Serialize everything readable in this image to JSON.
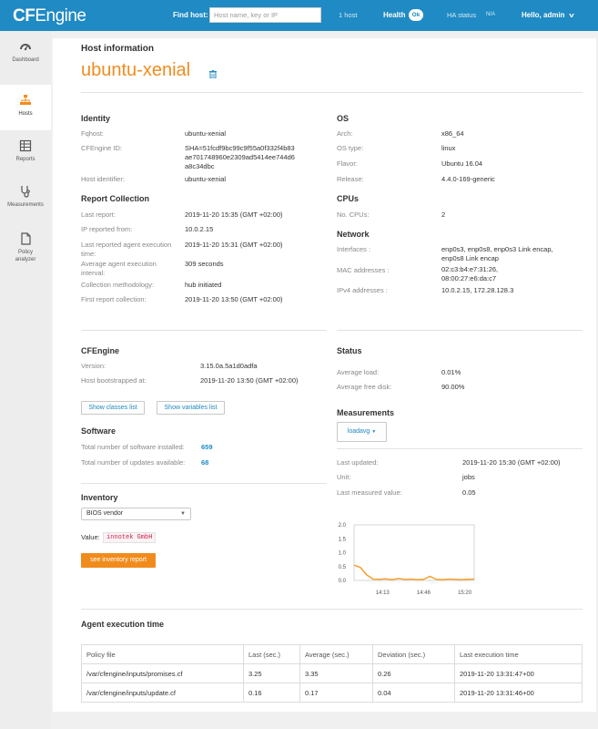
{
  "topbar": {
    "logo_bold": "CF",
    "logo_rest": "Engine",
    "find_label": "Find host:",
    "find_placeholder": "Host name, key or IP",
    "host_count": "1 host",
    "health_label": "Health",
    "health_badge": "Ok",
    "ha_label": "HA status",
    "ha_value": "N/A",
    "user_greeting": "Hello, admin"
  },
  "sidebar": {
    "items": [
      {
        "label": "Dashboard",
        "icon": "dashboard-icon"
      },
      {
        "label": "Hosts",
        "icon": "hosts-icon"
      },
      {
        "label": "Reports",
        "icon": "reports-icon"
      },
      {
        "label": "Measurements",
        "icon": "measurements-icon"
      },
      {
        "label": "Policy analyzer",
        "icon": "policy-analyzer-icon"
      }
    ]
  },
  "host": {
    "section_title": "Host information",
    "hostname": "ubuntu-xenial"
  },
  "identity": {
    "title": "Identity",
    "fqhost_label": "Fqhost:",
    "fqhost": "ubuntu-xenial",
    "cfengine_id_label": "CFEngine ID:",
    "cfengine_id_1": "SHA=51fcdf9bc99c9f55a0f332f4b83",
    "cfengine_id_2": "ae701748960e2309ad5414ee744d6",
    "cfengine_id_3": "a8c34dbc",
    "host_identifier_label": "Host identifier:",
    "host_identifier": "ubuntu-xenial"
  },
  "report_collection": {
    "title": "Report Collection",
    "last_report_label": "Last report:",
    "last_report": "2019-11-20 15:35 (GMT +02:00)",
    "ip_reported_label": "IP reported from:",
    "ip_reported": "10.0.2.15",
    "last_agent_label_1": "Last reported agent execution",
    "last_agent_label_2": "time:",
    "last_agent": "2019-11-20 15:31 (GMT +02:00)",
    "avg_agent_label_1": "Average agent execution",
    "avg_agent_label_2": "interval:",
    "avg_agent": "309 seconds",
    "methodology_label": "Collection methodology:",
    "methodology": "hub initiated",
    "first_report_label": "First report collection:",
    "first_report": "2019-11-20 13:50 (GMT +02:00)"
  },
  "os": {
    "title": "OS",
    "arch_label": "Arch:",
    "arch": "x86_64",
    "type_label": "OS type:",
    "type": "linux",
    "flavor_label": "Flavor:",
    "flavor": "Ubuntu 16.04",
    "release_label": "Release:",
    "release": "4.4.0-169-generic"
  },
  "cpus": {
    "title": "CPUs",
    "count_label": "No. CPUs:",
    "count": "2"
  },
  "network": {
    "title": "Network",
    "interfaces_label": "Interfaces :",
    "interfaces_1": "enp0s3, enp0s8, enp0s3 Link encap,",
    "interfaces_2": "enp0s8 Link encap",
    "mac_label": "MAC addresses :",
    "mac_1": "02:c3:b4:e7:31:26,",
    "mac_2": "08:00:27:e6:da:c7",
    "ipv4_label": "IPv4 addresses :",
    "ipv4": "10.0.2.15, 172.28.128.3"
  },
  "cfengine": {
    "title": "CFEngine",
    "version_label": "Version:",
    "version": "3.15.0a.5a1d0adfa",
    "bootstrapped_label": "Host bootstrapped at:",
    "bootstrapped": "2019-11-20 13:50 (GMT +02:00)",
    "classes_button": "Show classes list",
    "variables_button": "Show variables list"
  },
  "software": {
    "title": "Software",
    "installed_label": "Total number of software installed:",
    "installed": "659",
    "updates_label": "Total number of updates available:",
    "updates": "68"
  },
  "inventory": {
    "title": "Inventory",
    "selected": "BIOS vendor",
    "value_label": "Value:",
    "value": "innotek GmbH",
    "report_button": "see inventory report"
  },
  "status": {
    "title": "Status",
    "load_label": "Average load:",
    "load": "0.01%",
    "disk_label": "Average free disk:",
    "disk": "90.00%"
  },
  "measurements": {
    "title": "Measurements",
    "dropdown": "loadavg",
    "updated_label": "Last updated:",
    "updated": "2019-11-20 15:30 (GMT +02:00)",
    "unit_label": "Unit:",
    "unit": "jobs",
    "last_value_label": "Last measured value:",
    "last_value": "0.05"
  },
  "chart_data": {
    "type": "line",
    "x": [
      0,
      1,
      2,
      3,
      4,
      5,
      6,
      7,
      8,
      9,
      10,
      11,
      12,
      13,
      14,
      15,
      16,
      17,
      18,
      19
    ],
    "values": [
      0.55,
      0.47,
      0.2,
      0.05,
      0.04,
      0.06,
      0.03,
      0.07,
      0.04,
      0.05,
      0.03,
      0.04,
      0.15,
      0.04,
      0.03,
      0.05,
      0.04,
      0.03,
      0.04,
      0.05
    ],
    "x_tick_labels": [
      "14:13",
      "14:46",
      "15:20"
    ],
    "x_tick_positions": [
      4.5,
      11,
      17.5
    ],
    "y_ticks": [
      "0.0",
      "0.5",
      "1.0",
      "1.5",
      "2.0"
    ],
    "ylim": [
      0,
      2.0
    ],
    "line_color": "#f5a030"
  },
  "agent_exec": {
    "title": "Agent execution time",
    "columns": [
      "Policy file",
      "Last (sec.)",
      "Average (sec.)",
      "Deviation (sec.)",
      "Last execution time"
    ],
    "rows": [
      [
        "/var/cfengine/inputs/promises.cf",
        "3.25",
        "3.35",
        "0.26",
        "2019-11-20 13:31:47+00"
      ],
      [
        "/var/cfengine/inputs/update.cf",
        "0.16",
        "0.17",
        "0.04",
        "2019-11-20 13:31:46+00"
      ]
    ]
  }
}
